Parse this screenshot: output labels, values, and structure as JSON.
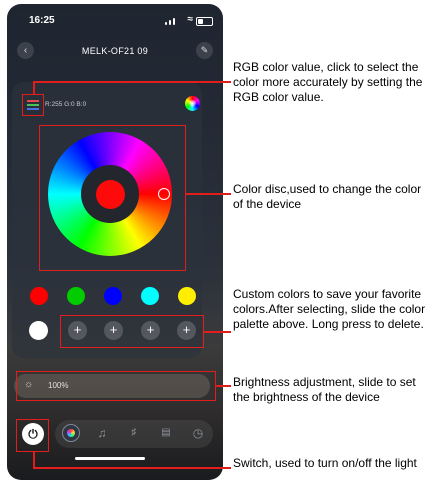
{
  "status_bar": {
    "time": "16:25"
  },
  "header": {
    "title": "MELK-OF21  09",
    "back_icon": "chevron-left-icon",
    "edit_icon": "pencil-icon"
  },
  "color_panel": {
    "rgb_value": "R:255 G:0 B:0",
    "selected_color": "#ff0000",
    "preset_colors": [
      "#ff0000",
      "#00cc00",
      "#0000ff",
      "#00ffff",
      "#ffee00"
    ],
    "custom_colors": [
      "#ffffff"
    ],
    "add_label": "+"
  },
  "brightness": {
    "value_label": "100%",
    "level": 1.0
  },
  "bottom_bar": {
    "tabs": [
      "power-icon",
      "color-wheel-icon",
      "music-note-icon",
      "mixer-sliders-icon",
      "scene-icon",
      "timer-icon"
    ]
  },
  "annotations": {
    "rgb": "RGB color value, click to select the color more accurately by setting the RGB color value.",
    "disc": "Color disc,used to change the color of the device",
    "custom": "Custom colors to save your favorite colors.After selecting, slide the color palette above. Long press to delete.",
    "brightness": "Brightness adjustment, slide to set the brightness of the device",
    "switch": "Switch, used to turn on/off the light"
  },
  "accent_color": "#e31c1c"
}
